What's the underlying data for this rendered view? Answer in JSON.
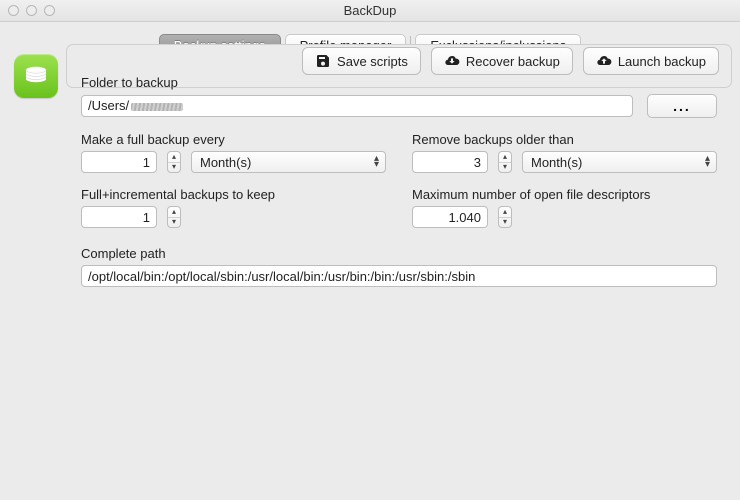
{
  "window": {
    "title": "BackDup"
  },
  "tabs": {
    "backup_settings": "Backup settings",
    "profile_manager": "Profile manager",
    "exclusions": "Exclussions/inclussions",
    "active": "backup_settings"
  },
  "form": {
    "folder_to_backup_label": "Folder to backup",
    "folder_to_backup_prefix": "/Users/",
    "browse_label": "...",
    "full_backup_every_label": "Make a full backup every",
    "full_backup_every_value": "1",
    "full_backup_every_unit": "Month(s)",
    "remove_older_label": "Remove backups older than",
    "remove_older_value": "3",
    "remove_older_unit": "Month(s)",
    "incrementals_label": "Full+incremental backups to keep",
    "incrementals_value": "1",
    "max_fd_label": "Maximum number of open file descriptors",
    "max_fd_value": "1.040",
    "complete_path_label": "Complete path",
    "complete_path_value": "/opt/local/bin:/opt/local/sbin:/usr/local/bin:/usr/bin:/bin:/usr/sbin:/sbin"
  },
  "buttons": {
    "save_scripts": "Save scripts",
    "recover_backup": "Recover backup",
    "launch_backup": "Launch backup"
  }
}
